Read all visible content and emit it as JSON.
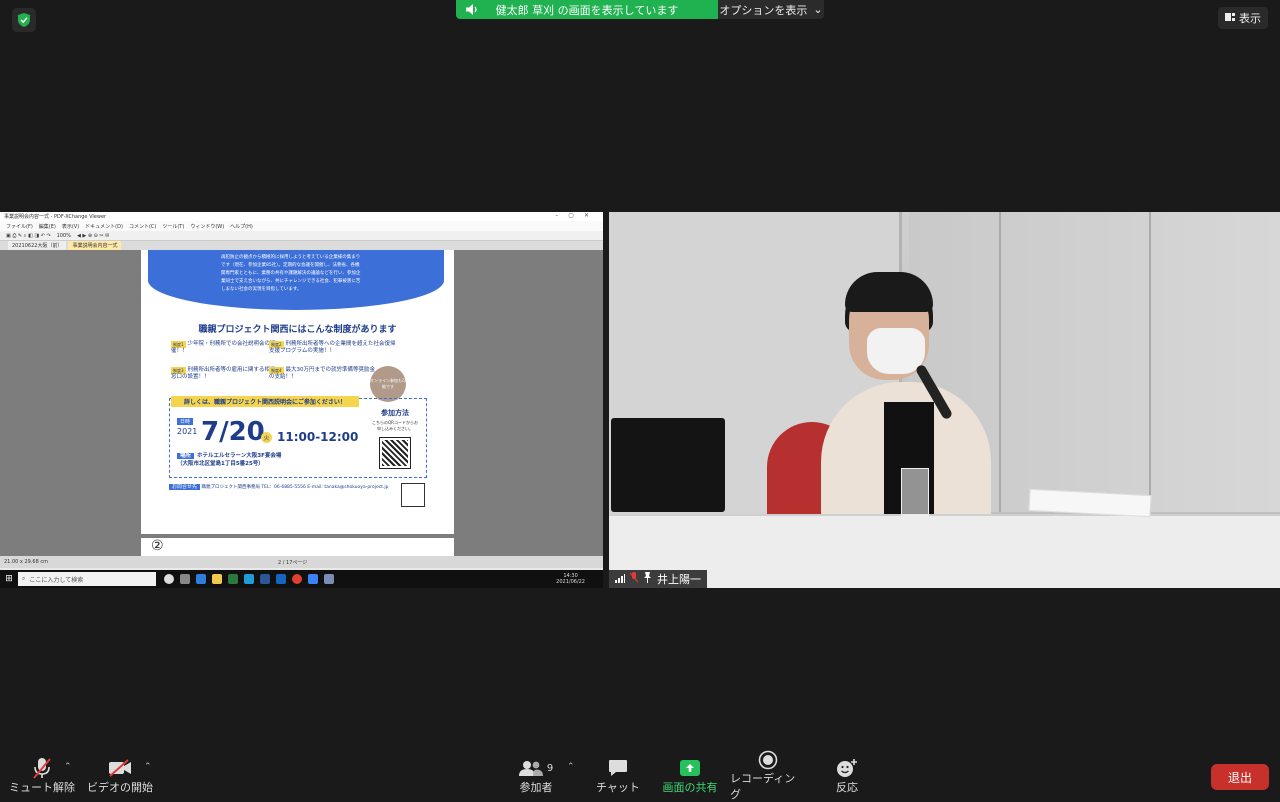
{
  "security_icon": "shield-check-icon",
  "share_banner": {
    "text": "健太郎 草刈 の画面を表示しています",
    "options": "オプションを表示"
  },
  "view_button": "表示",
  "shared_screen": {
    "window_title": "事業説明会内容一式 - PDF-XChange Viewer",
    "menu": [
      "ファイル(F)",
      "編集(E)",
      "表示(V)",
      "ドキュメント(D)",
      "コメント(C)",
      "ツール(T)",
      "ウィンドウ(W)",
      "ヘルプ(H)"
    ],
    "zoom": "100%",
    "tabs": [
      "20210622大阪（前）",
      "事業説明会内容一式"
    ],
    "flyer": {
      "intro": "再犯防止の観点から積極的に採用しようと考えている企業様の集まりです（現在、参加企業85社）。定期的な会議を開催し、法務省、各機関専門家とともに、業務の共有や課題解決の議論などを行い、参加企業同士で支え合いながら、共にチャレンジできる社会、犯罪被害に苦しまない社会の実現を目指しています。",
      "heading": "職親プロジェクト関西にはこんな制度があります",
      "items": [
        {
          "badge": "制度1",
          "text": "少年院・刑務所での会社説明会の開催！！"
        },
        {
          "badge": "制度2",
          "text": "刑務所出所者等への企業間を超えた社会復帰支援プログラムの実施！！"
        },
        {
          "badge": "制度3",
          "text": "刑務所出所者等の雇用に関する相談窓口の設置！！"
        },
        {
          "badge": "制度4",
          "text": "最大30万円までの就労準備等奨励金の支給！！"
        }
      ],
      "bubble": "オンライン参加も可能です",
      "banner": "詳しくは、職親プロジェクト関西説明会にご参加ください！",
      "date_tag": "日時",
      "year": "2021",
      "date": "7/20",
      "dow": "火",
      "time": "11:00-12:00",
      "venue_tag": "場所",
      "venue": "ホテルエルセラーン大阪3F宴会場",
      "address": "（大阪市北区堂島1丁目5番25号）",
      "join_title": "参加方法",
      "join_text": "こちらのQRコードからお申し込みください。",
      "contact_tag": "お問合せ先",
      "contact": "職親プロジェクト関西事務局 TEL：06-6885-5556 E-mail: tanaka@shokuoya-project.jp",
      "page2_mark": "②"
    },
    "status_size": "21.00 x 29.68 cm",
    "page_indicator": "2 / 17ページ",
    "taskbar_search": "ここに入力して検索",
    "clock_time": "14:30",
    "clock_date": "2021/06/22"
  },
  "participant": {
    "name": "井上陽一"
  },
  "toolbar": {
    "mute": "ミュート解除",
    "video": "ビデオの開始",
    "participants": "参加者",
    "participants_count": "9",
    "chat": "チャット",
    "share": "画面の共有",
    "record": "レコーディング",
    "reactions": "反応",
    "end": "退出"
  },
  "colors": {
    "share_green": "#20b150",
    "end_red": "#c7302b",
    "flyer_blue": "#3c6fd7",
    "flyer_yellow": "#f5d54e"
  }
}
